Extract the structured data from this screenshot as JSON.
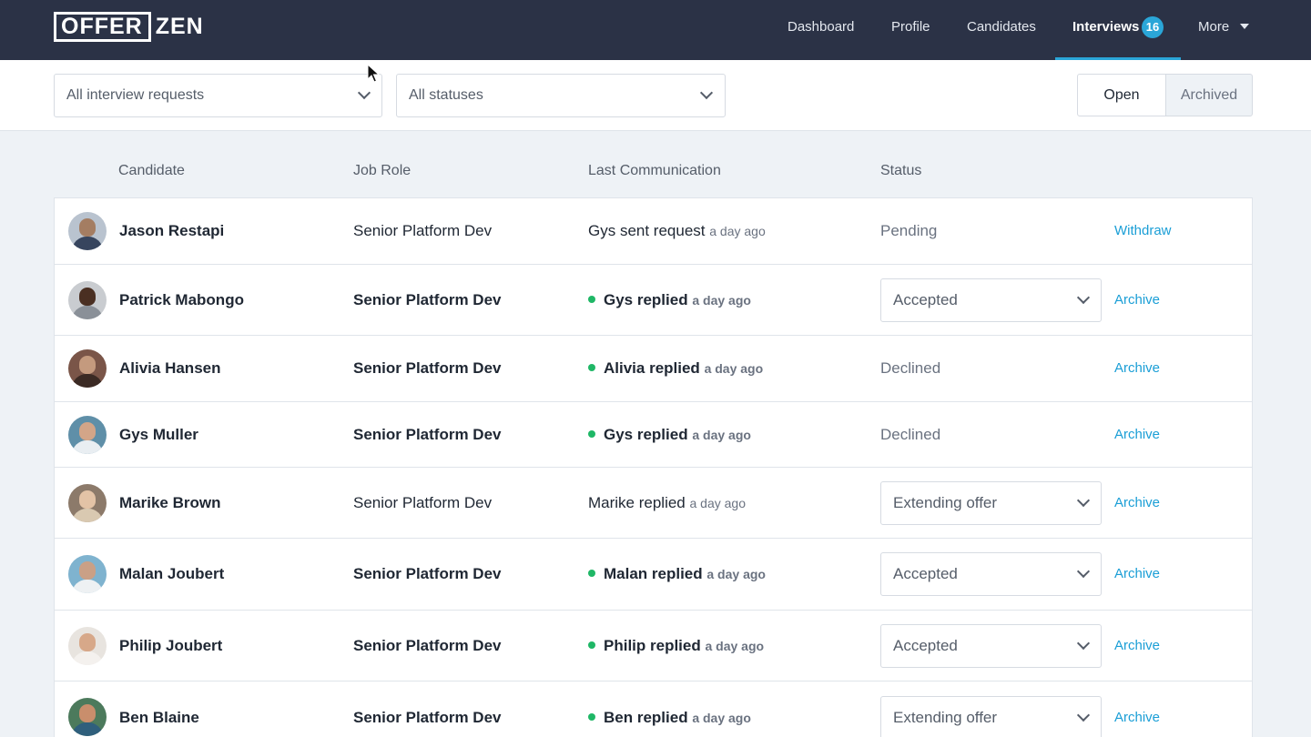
{
  "brand": {
    "logo_box": "OFFER",
    "logo_rest": "ZEN"
  },
  "nav": {
    "dashboard": "Dashboard",
    "profile": "Profile",
    "candidates": "Candidates",
    "interviews": "Interviews",
    "interviews_badge": "16",
    "more": "More"
  },
  "filters": {
    "requests": "All interview requests",
    "statuses": "All statuses",
    "open": "Open",
    "archived": "Archived"
  },
  "columns": {
    "candidate": "Candidate",
    "job_role": "Job Role",
    "last_communication": "Last Communication",
    "status": "Status"
  },
  "rows": [
    {
      "name": "Jason Restapi",
      "role": "Senior Platform Dev",
      "comm": "Gys sent request",
      "ago": "a day ago",
      "unread": false,
      "status": "Pending",
      "status_dropdown": false,
      "action": "Withdraw"
    },
    {
      "name": "Patrick Mabongo",
      "role": "Senior Platform Dev",
      "comm": "Gys replied",
      "ago": "a day ago",
      "unread": true,
      "status": "Accepted",
      "status_dropdown": true,
      "action": "Archive"
    },
    {
      "name": "Alivia Hansen",
      "role": "Senior Platform Dev",
      "comm": "Alivia replied",
      "ago": "a day ago",
      "unread": true,
      "status": "Declined",
      "status_dropdown": false,
      "action": "Archive"
    },
    {
      "name": "Gys Muller",
      "role": "Senior Platform Dev",
      "comm": "Gys replied",
      "ago": "a day ago",
      "unread": true,
      "status": "Declined",
      "status_dropdown": false,
      "action": "Archive"
    },
    {
      "name": "Marike Brown",
      "role": "Senior Platform Dev",
      "comm": "Marike replied",
      "ago": "a day ago",
      "unread": false,
      "status": "Extending offer",
      "status_dropdown": true,
      "action": "Archive"
    },
    {
      "name": "Malan Joubert",
      "role": "Senior Platform Dev",
      "comm": "Malan replied",
      "ago": "a day ago",
      "unread": true,
      "status": "Accepted",
      "status_dropdown": true,
      "action": "Archive"
    },
    {
      "name": "Philip Joubert",
      "role": "Senior Platform Dev",
      "comm": "Philip replied",
      "ago": "a day ago",
      "unread": true,
      "status": "Accepted",
      "status_dropdown": true,
      "action": "Archive"
    },
    {
      "name": "Ben Blaine",
      "role": "Senior Platform Dev",
      "comm": "Ben replied",
      "ago": "a day ago",
      "unread": true,
      "status": "Extending offer",
      "status_dropdown": true,
      "action": "Archive"
    }
  ],
  "colors": {
    "nav_bg": "#2b3246",
    "accent": "#2aa6d8",
    "link": "#1a9ed6",
    "unread_dot": "#1fb766"
  }
}
